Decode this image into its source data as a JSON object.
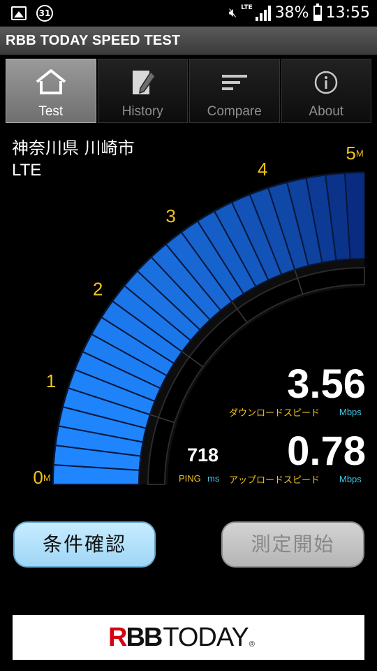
{
  "status_bar": {
    "notification_badge": "31",
    "network": "LTE",
    "battery": "38%",
    "time": "13:55"
  },
  "app": {
    "title": "RBB TODAY SPEED TEST"
  },
  "tabs": [
    {
      "label": "Test",
      "icon": "home-icon",
      "active": true
    },
    {
      "label": "History",
      "icon": "notepad-pencil-icon",
      "active": false
    },
    {
      "label": "Compare",
      "icon": "compare-lines-icon",
      "active": false
    },
    {
      "label": "About",
      "icon": "info-icon",
      "active": false
    }
  ],
  "location": {
    "area": "神奈川県 川崎市",
    "network": "LTE"
  },
  "gauge": {
    "ticks": [
      "0",
      "1",
      "2",
      "3",
      "4",
      "5"
    ],
    "tick_unit": "M",
    "min": 0,
    "max": 5,
    "download_value": 3.56,
    "upload_value": 0.78,
    "fill_color": "#1d7cf0",
    "track_color": "#000000"
  },
  "results": {
    "download": {
      "value": "3.56",
      "label": "ダウンロードスピード",
      "unit": "Mbps"
    },
    "upload": {
      "value": "0.78",
      "label": "アップロードスピード",
      "unit": "Mbps"
    },
    "ping": {
      "value": "718",
      "label": "PING",
      "unit": "ms"
    }
  },
  "buttons": {
    "conditions": "条件確認",
    "start": "測定開始"
  },
  "banner": {
    "logo_text": "RBBTODAY",
    "logo_lead": "R",
    "logo_mid": "BB",
    "logo_tail": "TODAY",
    "logo_mark": "®"
  },
  "colors": {
    "accent_yellow": "#f3c319",
    "unit_cyan": "#3fc7e6",
    "gauge_blue": "#1d7cf0",
    "button_blue": "#b5e2fb"
  }
}
